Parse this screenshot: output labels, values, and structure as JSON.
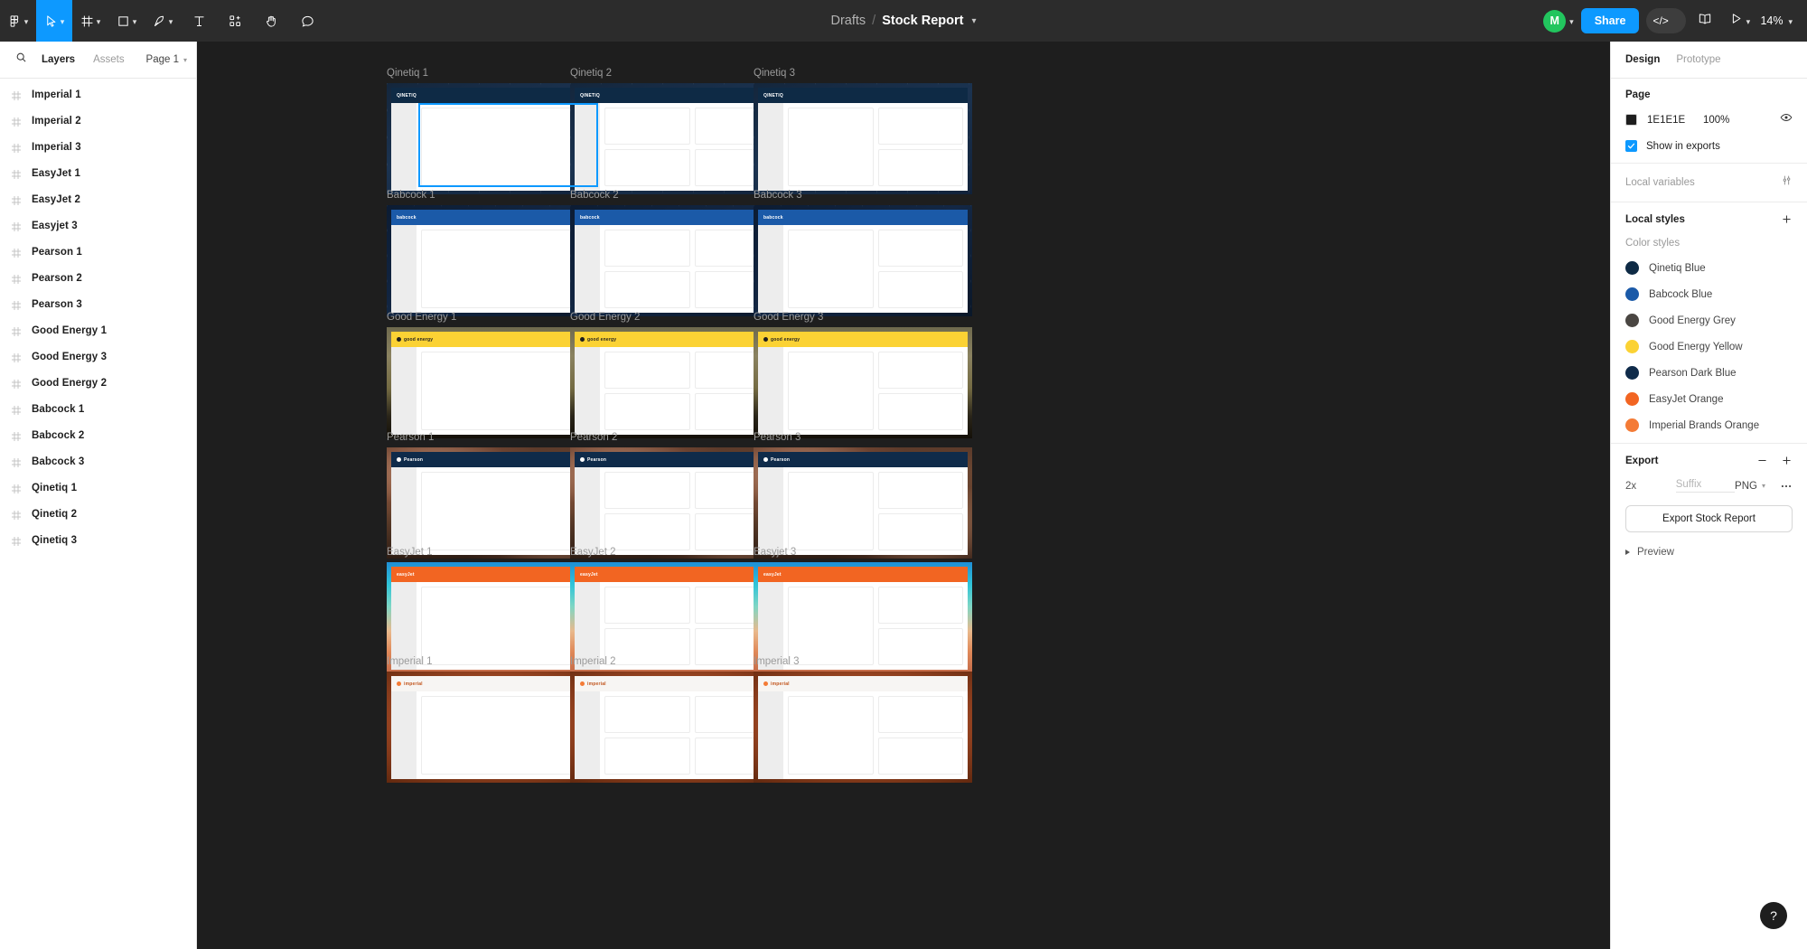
{
  "toolbar": {
    "tools": [
      {
        "name": "figma-menu-icon",
        "caret": true
      },
      {
        "name": "move-tool-icon",
        "caret": true,
        "active": true
      },
      {
        "name": "frame-tool-icon",
        "caret": true
      },
      {
        "name": "shape-tool-icon",
        "caret": true
      },
      {
        "name": "pen-tool-icon",
        "caret": true
      },
      {
        "name": "text-tool-icon",
        "caret": false
      },
      {
        "name": "components-tool-icon",
        "caret": false
      },
      {
        "name": "hand-tool-icon",
        "caret": false
      },
      {
        "name": "comment-tool-icon",
        "caret": false
      }
    ],
    "breadcrumb_project": "Drafts",
    "breadcrumb_separator": "/",
    "breadcrumb_file": "Stock Report",
    "avatar_initial": "M",
    "share_label": "Share",
    "dev_mode_label": "</>",
    "zoom_label": "14%"
  },
  "sidebar": {
    "search_placeholder": "",
    "tab_layers": "Layers",
    "tab_assets": "Assets",
    "page_label": "Page 1",
    "layers": [
      "Imperial 1",
      "Imperial 2",
      "Imperial 3",
      "EasyJet 1",
      "EasyJet 2",
      "Easyjet 3",
      "Pearson 1",
      "Pearson 2",
      "Pearson 3",
      "Good Energy 1",
      "Good Energy 3",
      "Good Energy 2",
      "Babcock 1",
      "Babcock 2",
      "Babcock 3",
      "Qinetiq 1",
      "Qinetiq 2",
      "Qinetiq 3"
    ]
  },
  "canvas": {
    "frames": [
      {
        "label": "Qinetiq 1",
        "brand": "qinetiq",
        "logo": "QINETIQ",
        "layout": "single",
        "selected": true
      },
      {
        "label": "Qinetiq 2",
        "brand": "qinetiq",
        "logo": "QINETIQ",
        "layout": "quad",
        "selected": false
      },
      {
        "label": "Qinetiq 3",
        "brand": "qinetiq",
        "logo": "QINETIQ",
        "layout": "split",
        "selected": false
      },
      {
        "label": "Babcock 1",
        "brand": "babcock",
        "logo": "babcock",
        "layout": "single",
        "selected": false
      },
      {
        "label": "Babcock 2",
        "brand": "babcock",
        "logo": "babcock",
        "layout": "quad",
        "selected": false
      },
      {
        "label": "Babcock 3",
        "brand": "babcock",
        "logo": "babcock",
        "layout": "split",
        "selected": false
      },
      {
        "label": "Good Energy 1",
        "brand": "goodenergy",
        "logo": "good energy",
        "layout": "single",
        "selected": false
      },
      {
        "label": "Good Energy 2",
        "brand": "goodenergy",
        "logo": "good energy",
        "layout": "quad",
        "selected": false
      },
      {
        "label": "Good Energy 3",
        "brand": "goodenergy",
        "logo": "good energy",
        "layout": "split",
        "selected": false
      },
      {
        "label": "Pearson 1",
        "brand": "pearson",
        "logo": "Pearson",
        "layout": "single",
        "selected": false
      },
      {
        "label": "Pearson 2",
        "brand": "pearson",
        "logo": "Pearson",
        "layout": "quad",
        "selected": false
      },
      {
        "label": "Pearson 3",
        "brand": "pearson",
        "logo": "Pearson",
        "layout": "split",
        "selected": false
      },
      {
        "label": "EasyJet 1",
        "brand": "easyjet",
        "logo": "easyJet",
        "layout": "single",
        "selected": false
      },
      {
        "label": "EasyJet 2",
        "brand": "easyjet",
        "logo": "easyJet",
        "layout": "quad",
        "selected": false
      },
      {
        "label": "Easyjet 3",
        "brand": "easyjet",
        "logo": "easyJet",
        "layout": "split",
        "selected": false
      },
      {
        "label": "Imperial 1",
        "brand": "imperial",
        "logo": "imperial",
        "layout": "single",
        "selected": false
      },
      {
        "label": "Imperial 2",
        "brand": "imperial",
        "logo": "imperial",
        "layout": "quad",
        "selected": false
      },
      {
        "label": "Imperial 3",
        "brand": "imperial",
        "logo": "imperial",
        "layout": "split",
        "selected": false
      }
    ]
  },
  "right_panel": {
    "tab_design": "Design",
    "tab_prototype": "Prototype",
    "page_section_title": "Page",
    "page_color_hex": "1E1E1E",
    "page_color_value": "#1E1E1E",
    "page_color_opacity": "100%",
    "show_in_exports_label": "Show in exports",
    "local_variables_label": "Local variables",
    "local_styles_title": "Local styles",
    "color_styles_label": "Color styles",
    "color_styles": [
      {
        "name": "Qinetiq Blue",
        "hex": "#0e2a45"
      },
      {
        "name": "Babcock Blue",
        "hex": "#1b5aa8"
      },
      {
        "name": "Good Energy Grey",
        "hex": "#4a4642"
      },
      {
        "name": "Good Energy Yellow",
        "hex": "#fbd234"
      },
      {
        "name": "Pearson Dark Blue",
        "hex": "#0f2b4a"
      },
      {
        "name": "EasyJet Orange",
        "hex": "#f26522"
      },
      {
        "name": "Imperial Brands Orange",
        "hex": "#f47b36"
      }
    ],
    "export_title": "Export",
    "export_scale": "2x",
    "export_suffix_placeholder": "Suffix",
    "export_format": "PNG",
    "export_button_label": "Export Stock Report",
    "preview_label": "Preview"
  },
  "help": {
    "label": "?"
  }
}
